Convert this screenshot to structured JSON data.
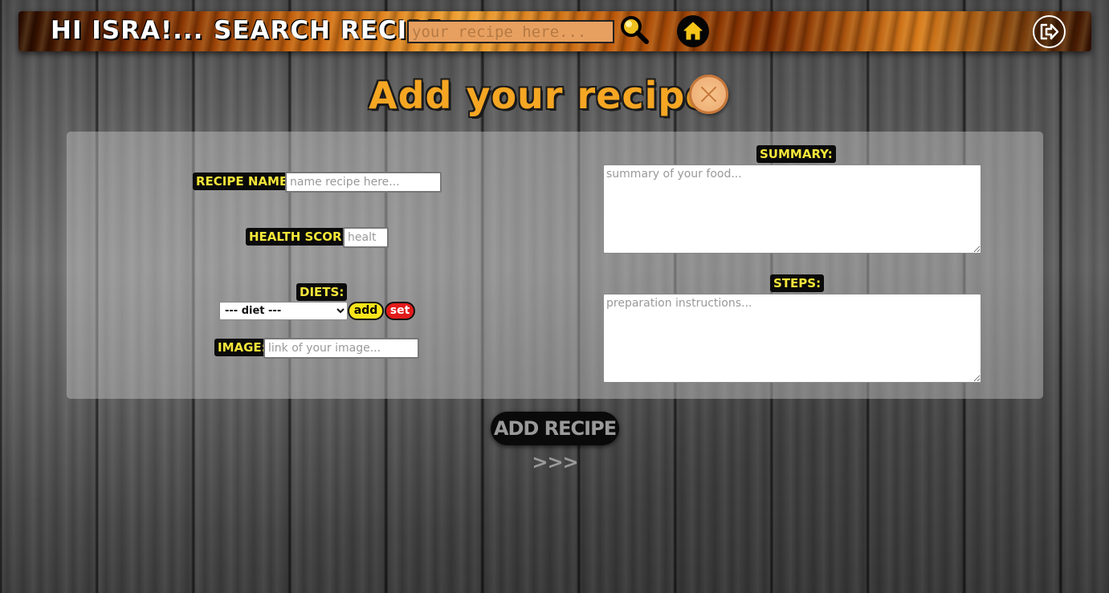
{
  "header": {
    "greeting": "HI ISRA!...",
    "search_label": "SEARCH RECIPE:",
    "search_placeholder": "your recipe here...",
    "icons": [
      "search-icon",
      "home-icon",
      "logout-icon"
    ]
  },
  "main": {
    "title": "Add your recipe",
    "title_icon": "pie-icon"
  },
  "form": {
    "recipe_name": {
      "label": "RECIPE NAME:",
      "placeholder": "name recipe here..."
    },
    "health_score": {
      "label": "HEALTH SCORE:",
      "placeholder": "healt"
    },
    "diets": {
      "label": "DIETS:",
      "selected": "--- diet ---",
      "add_label": "add",
      "set_label": "set"
    },
    "image": {
      "label": "IMAGE:",
      "placeholder": "link of your image..."
    },
    "summary": {
      "label": "SUMMARY:",
      "placeholder": "summary of your food..."
    },
    "steps": {
      "label": "STEPS:",
      "placeholder": "preparation instructions..."
    },
    "submit_label": "ADD RECIPE >>>"
  },
  "colors": {
    "title": "#f5a623",
    "label_text": "#f5e63a",
    "label_bg": "#0a0a0a",
    "add_button": "#f8e51a",
    "set_button": "#e21b1b"
  }
}
